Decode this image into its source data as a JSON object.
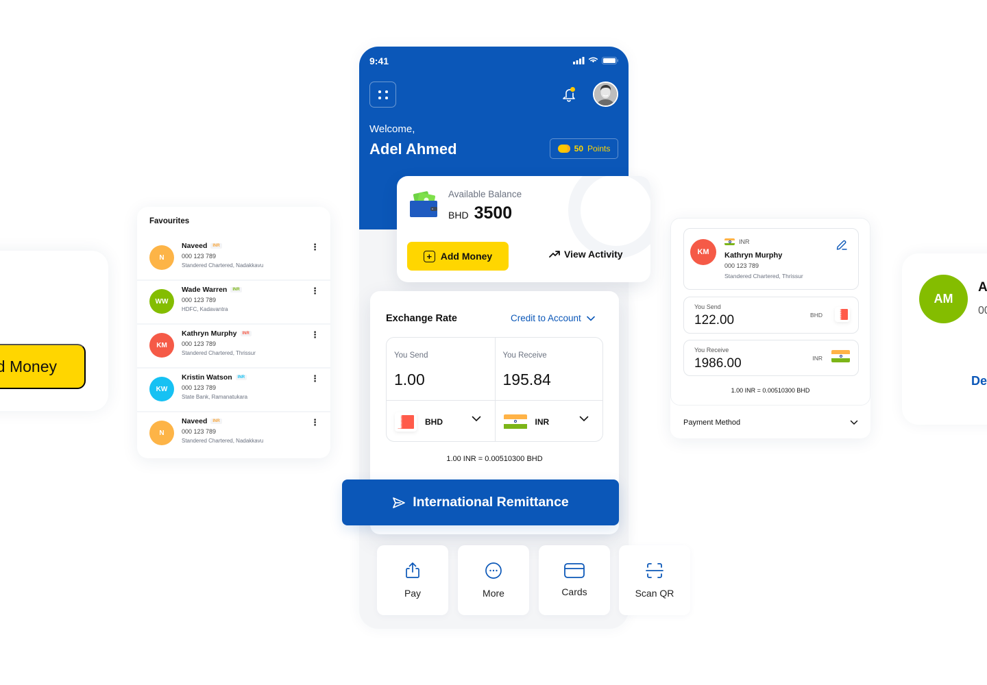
{
  "left_card": {
    "button_label": "d Money"
  },
  "favourites": {
    "title": "Favourites",
    "items": [
      {
        "initials": "N",
        "name": "Naveed",
        "currency": "INR",
        "account": "000 123 789",
        "bank": "Standered Chartered, Nadakkavu",
        "avatar_color": "#FDB447",
        "badge_color": "#F7A53B"
      },
      {
        "initials": "WW",
        "name": "Wade Warren",
        "currency": "INR",
        "account": "000 123 789",
        "bank": "HDFC, Kadavantra",
        "avatar_color": "#84BD00",
        "badge_color": "#7CB518"
      },
      {
        "initials": "KM",
        "name": "Kathryn Murphy",
        "currency": "INR",
        "account": "000 123 789",
        "bank": "Standered Chartered, Thrissur",
        "avatar_color": "#F55A47",
        "badge_color": "#F55A47"
      },
      {
        "initials": "KW",
        "name": "Kristin Watson",
        "currency": "INR",
        "account": "000 123 789",
        "bank": "State Bank, Ramanatukara",
        "avatar_color": "#16C1F3",
        "badge_color": "#16C1F3"
      },
      {
        "initials": "N",
        "name": "Naveed",
        "currency": "INR",
        "account": "000 123 789",
        "bank": "Standered Chartered, Nadakkavu",
        "avatar_color": "#FDB447",
        "badge_color": "#F7A53B"
      }
    ]
  },
  "phone": {
    "status_time": "9:41",
    "welcome": "Welcome,",
    "user_name": "Adel Ahmed",
    "points_value": "50",
    "points_label": "Points",
    "balance": {
      "label": "Available Balance",
      "currency": "BHD",
      "amount": "3500",
      "add_money": "Add Money",
      "view_activity": "View Activity"
    },
    "exchange": {
      "title": "Exchange Rate",
      "mode": "Credit to Account",
      "send_label": "You Send",
      "send_value": "1.00",
      "send_currency": "BHD",
      "receive_label": "You Receive",
      "receive_value": "195.84",
      "receive_currency": "INR",
      "rate": "1.00 INR = 0.00510300 BHD"
    },
    "remittance_button": "International Remittance",
    "quick_actions": [
      {
        "label": "Pay",
        "icon": "share-upload-icon"
      },
      {
        "label": "More",
        "icon": "more-dots-icon"
      },
      {
        "label": "Cards",
        "icon": "card-icon"
      },
      {
        "label": "Scan QR",
        "icon": "scan-qr-icon"
      }
    ]
  },
  "recipient": {
    "initials": "KM",
    "currency": "INR",
    "name": "Kathryn Murphy",
    "account": "000 123 789",
    "bank": "Standered Chartered, Thrissur",
    "send_label": "You Send",
    "send_value": "122.00",
    "send_currency": "BHD",
    "receive_label": "You Receive",
    "receive_value": "1986.00",
    "receive_currency": "INR",
    "rate": "1.00 INR = 0.00510300 BHD",
    "payment_method": "Payment Method"
  },
  "far_right": {
    "initials": "AM",
    "name": "A",
    "account": "00",
    "link": "De"
  },
  "colors": {
    "brand_blue": "#0B57B8",
    "accent_yellow": "#FFD600",
    "background": "#F4F5F7"
  }
}
